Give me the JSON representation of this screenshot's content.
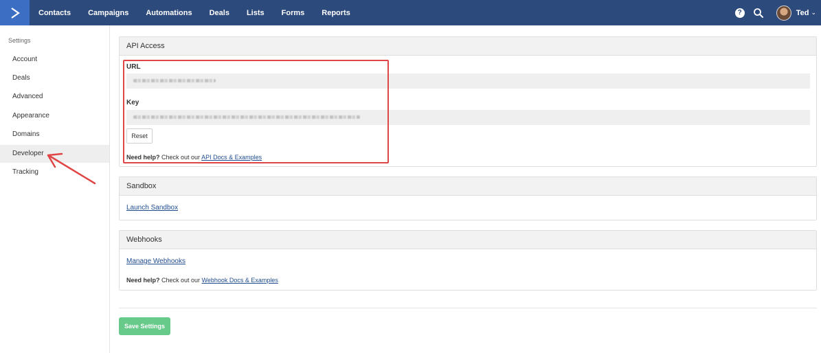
{
  "nav": {
    "items": [
      "Contacts",
      "Campaigns",
      "Automations",
      "Deals",
      "Lists",
      "Forms",
      "Reports"
    ],
    "help_icon_glyph": "?",
    "user_name": "Ted",
    "user_chevron": "⌄"
  },
  "sidebar": {
    "heading": "Settings",
    "items": [
      {
        "label": "Account"
      },
      {
        "label": "Deals"
      },
      {
        "label": "Advanced"
      },
      {
        "label": "Appearance"
      },
      {
        "label": "Domains"
      },
      {
        "label": "Developer",
        "active": true
      },
      {
        "label": "Tracking"
      }
    ]
  },
  "api_access": {
    "title": "API Access",
    "url_label": "URL",
    "key_label": "Key",
    "reset_label": "Reset",
    "help_prefix": "Need help?",
    "help_middle": " Check out our ",
    "help_link": "API Docs & Examples"
  },
  "sandbox": {
    "title": "Sandbox",
    "link": "Launch Sandbox"
  },
  "webhooks": {
    "title": "Webhooks",
    "link": "Manage Webhooks",
    "help_prefix": "Need help?",
    "help_middle": " Check out our ",
    "help_link": "Webhook Docs & Examples"
  },
  "save_button": "Save Settings",
  "colors": {
    "nav_bg": "#2d4a7d",
    "logo_bg": "#3c6fc4",
    "save_green": "#67c98a",
    "highlight_red": "#e04545",
    "link_blue": "#1f4c8f"
  },
  "icons": {
    "logo": "chevron-right-logo-icon",
    "help": "question-circle-icon",
    "search": "search-icon",
    "annotation": "red-arrow-icon"
  }
}
